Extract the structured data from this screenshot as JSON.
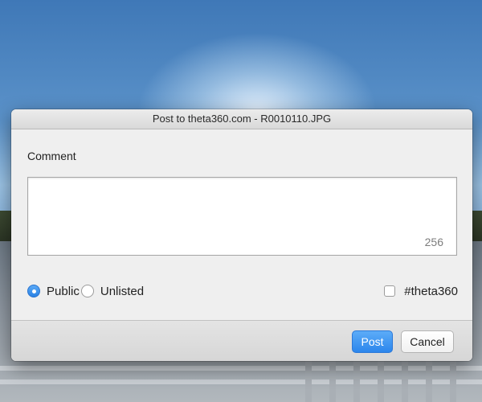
{
  "dialog": {
    "title": "Post to theta360.com - R0010110.JPG",
    "comment_label": "Comment",
    "comment_value": "",
    "char_count": "256"
  },
  "visibility": {
    "selected": "Public",
    "options": [
      {
        "label": "Public",
        "checked": true
      },
      {
        "label": "Unlisted",
        "checked": false
      }
    ]
  },
  "hashtag": {
    "label": "#theta360",
    "checked": false
  },
  "buttons": {
    "post_label": "Post",
    "cancel_label": "Cancel"
  },
  "colors": {
    "accent": "#2c86ec",
    "dialog_bg": "#efefef"
  }
}
